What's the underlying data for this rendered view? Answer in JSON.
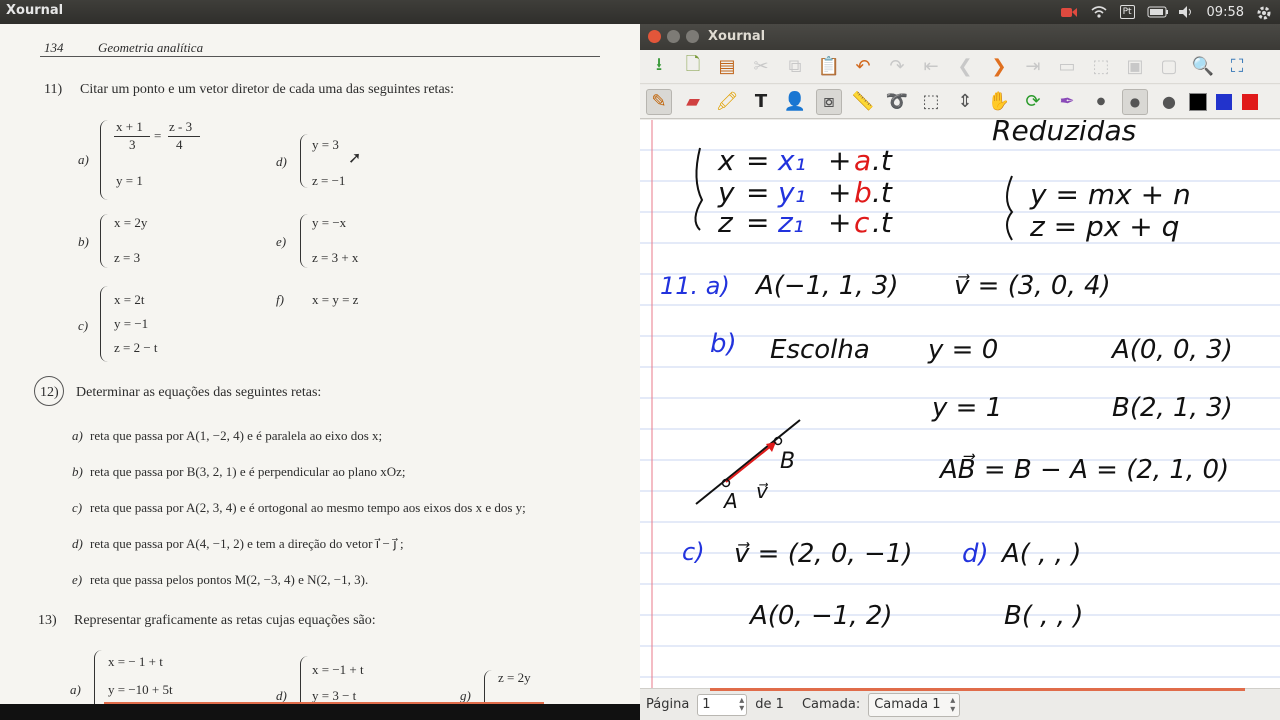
{
  "system_bar": {
    "app_title": "Xournal",
    "lang": "Pt",
    "time": "09:58"
  },
  "book": {
    "page_number": "134",
    "running_title": "Geometria analítica",
    "ex11": {
      "num": "11)",
      "stmt": "Citar um ponto e um vetor diretor de cada uma das seguintes retas:",
      "a_label": "a)",
      "a_frac1_num": "x + 1",
      "a_frac1_den": "3",
      "a_eq": "=",
      "a_frac2_num": "z - 3",
      "a_frac2_den": "4",
      "a_line2": "y = 1",
      "b_label": "b)",
      "b_line1": "x = 2y",
      "b_line2": "z = 3",
      "c_label": "c)",
      "c_line1": "x = 2t",
      "c_line2": "y = −1",
      "c_line3": "z = 2 − t",
      "d_label": "d)",
      "d_line1": "y = 3",
      "d_line2": "z = −1",
      "e_label": "e)",
      "e_line1": "y = −x",
      "e_line2": "z = 3 + x",
      "f_label": "f)",
      "f_line1": "x = y = z"
    },
    "ex12": {
      "num": "12)",
      "stmt": "Determinar as equações das seguintes retas:",
      "items": [
        {
          "label": "a)",
          "text": "reta que passa por  A(1, −2, 4)  e é paralela ao eixo dos  x;"
        },
        {
          "label": "b)",
          "text": "reta que passa por  B(3, 2, 1)  e é perpendicular ao plano  xOz;"
        },
        {
          "label": "c)",
          "text": "reta que passa por  A(2, 3, 4)  e é ortogonal ao mesmo tempo aos eixos dos  x  e dos  y;"
        },
        {
          "label": "d)",
          "text": "reta que passa por  A(4, −1, 2)  e tem a direção do vetor  i⃗ − j⃗ ;"
        },
        {
          "label": "e)",
          "text": "reta que passa pelos pontos  M(2, −3, 4)  e  N(2, −1, 3)."
        }
      ]
    },
    "ex13": {
      "num": "13)",
      "stmt": "Representar graficamente as retas cujas equações são:",
      "a_label": "a)",
      "a_line1": "x = − 1 + t",
      "a_line2": "y = −10 + 5t",
      "d_label": "d)",
      "d_line1": "x = −1 + t",
      "d_line2": "y = 3 − t",
      "g_label": "g)",
      "g_line1": "z = 2y"
    }
  },
  "xournal": {
    "window_title": "Xournal",
    "notes": {
      "title_word": "Reduzidas",
      "sys_x": [
        "x",
        "=",
        "x₁",
        "+",
        "a",
        ".t"
      ],
      "sys_y": [
        "y",
        "=",
        "y₁",
        "+",
        "b",
        ".t"
      ],
      "sys_z": [
        "z",
        "=",
        "z₁",
        "+",
        "c",
        ".t"
      ],
      "red_y": "y = mx + n",
      "red_z": "z = px + q",
      "n11a_label": "11. a)",
      "n11a_point": "A(−1, 1, 3)",
      "n11a_vec": "v⃗ = (3, 0, 4)",
      "b_label": "b)",
      "b_word": "Escolha",
      "b_y0": "y = 0",
      "b_A": "A(0, 0, 3)",
      "b_y1": "y = 1",
      "b_B": "B(2, 1, 3)",
      "b_AB": "AB⃗ = B − A = (2, 1, 0)",
      "fig_A": "A",
      "fig_B": "B",
      "fig_v": "v⃗",
      "c_label": "c)",
      "c_vec": "v⃗ = (2, 0, −1)",
      "c_point": "A(0, −1, 2)",
      "d_label": "d)",
      "d_A": "A(   ,   ,   )",
      "d_B": "B(   ,   ,   )"
    },
    "status": {
      "page_label": "Página",
      "page_value": "1",
      "of_label": "de 1",
      "layer_label": "Camada:",
      "layer_value": "Camada 1"
    },
    "colors": {
      "blue": "#2233dd",
      "red": "#e01a1a",
      "black": "#111111"
    }
  }
}
